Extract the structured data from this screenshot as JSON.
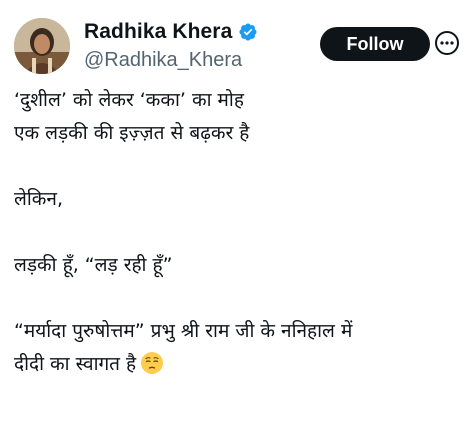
{
  "author": {
    "display_name": "Radhika Khera",
    "handle": "@Radhika_Khera",
    "verified": true
  },
  "actions": {
    "follow_label": "Follow"
  },
  "tweet": {
    "lines": [
      "‘दुशील’ को लेकर ‘कका’ का मोह",
      "एक लड़की की इज़्ज़त से बढ़कर है",
      "लेकिन,",
      "लड़की हूँ, “लड़ रही हूँ”",
      "“मर्यादा पुरुषोत्तम” प्रभु श्री राम जी के ननिहाल में",
      "दीदी का स्वागत है"
    ],
    "emoji": "pensive-face"
  },
  "colors": {
    "verified_badge": "#1d9bf0",
    "handle_text": "#536471",
    "follow_bg": "#0f1419",
    "follow_text": "#ffffff"
  }
}
